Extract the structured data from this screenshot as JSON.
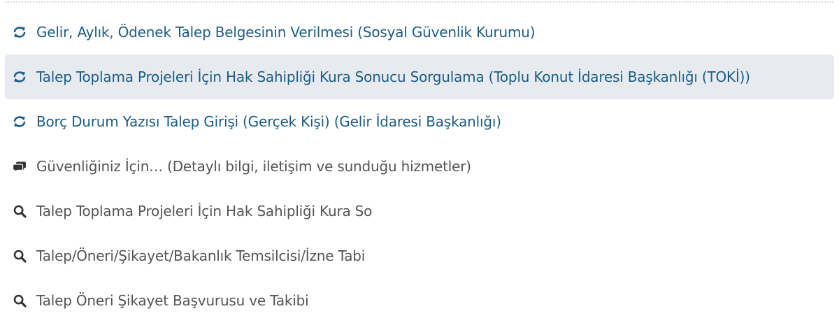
{
  "colors": {
    "service_link": "#1b5d87",
    "suggestion_text": "#555555",
    "active_row_bg": "#e7eaee",
    "icon_blue": "#1f5f8b",
    "icon_dark": "#333333"
  },
  "results": [
    {
      "kind": "service",
      "icon": "refresh-icon",
      "label": "Gelir, Aylık, Ödenek Talep Belgesinin Verilmesi (Sosyal Güvenlik Kurumu)"
    },
    {
      "kind": "service",
      "icon": "refresh-icon",
      "label": "Talep Toplama Projeleri İçin Hak Sahipliği Kura Sonucu Sorgulama (Toplu Konut İdaresi Başkanlığı (TOKİ))",
      "active": true
    },
    {
      "kind": "service",
      "icon": "refresh-icon",
      "label": "Borç Durum Yazısı Talep Girişi (Gerçek Kişi) (Gelir İdaresi Başkanlığı)"
    },
    {
      "kind": "info",
      "icon": "chat-icon",
      "label": "Güvenliğiniz İçin… (Detaylı bilgi, iletişim ve sunduğu hizmetler)"
    },
    {
      "kind": "search",
      "icon": "search-icon",
      "label": "Talep Toplama Projeleri İçin Hak Sahipliği Kura So"
    },
    {
      "kind": "search",
      "icon": "search-icon",
      "label": "Talep/Öneri/Şikayet/Bakanlık Temsilcisi/İzne Tabi"
    },
    {
      "kind": "search",
      "icon": "search-icon",
      "label": "Talep Öneri Şikayet Başvurusu ve Takibi"
    }
  ]
}
